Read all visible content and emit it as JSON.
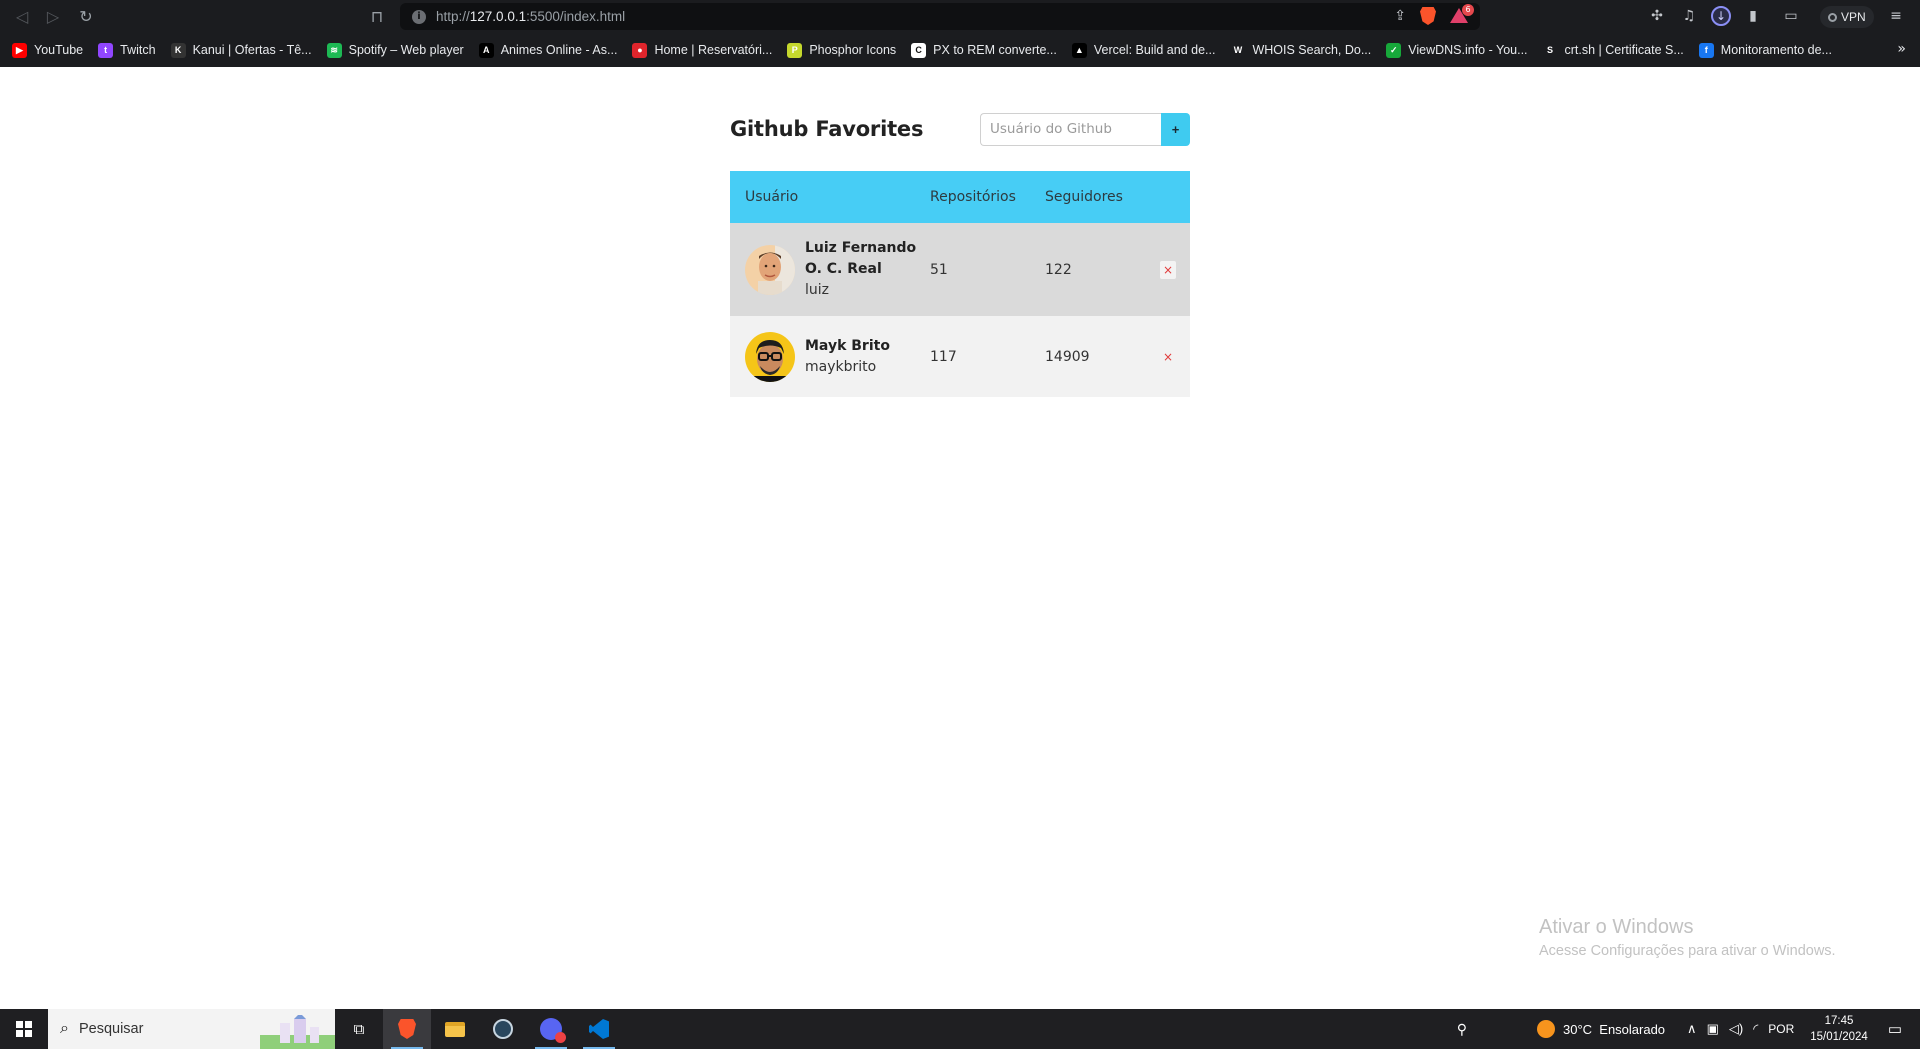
{
  "browser": {
    "url_scheme": "http://",
    "url_host": "127.0.0.1",
    "url_rest": ":5500/index.html",
    "vpn_label": "VPN",
    "notification_count": "6",
    "bookmarks": [
      {
        "label": "YouTube",
        "icon": "youtube-icon",
        "color": "#ff0000",
        "glyph": "▶"
      },
      {
        "label": "Twitch",
        "icon": "twitch-icon",
        "color": "#9146ff",
        "glyph": "t"
      },
      {
        "label": "Kanui | Ofertas - Tê...",
        "icon": "kanui-icon",
        "color": "#333333",
        "glyph": "K"
      },
      {
        "label": "Spotify – Web player",
        "icon": "spotify-icon",
        "color": "#1db954",
        "glyph": "≋"
      },
      {
        "label": "Animes Online - As...",
        "icon": "animes-icon",
        "color": "#000000",
        "glyph": "A"
      },
      {
        "label": "Home | Reservatóri...",
        "icon": "reservatorio-icon",
        "color": "#e0252c",
        "glyph": "●"
      },
      {
        "label": "Phosphor Icons",
        "icon": "phosphor-icon",
        "color": "#c5d82d",
        "glyph": "P"
      },
      {
        "label": "PX to REM converte...",
        "icon": "pxrem-icon",
        "color": "#ffffff",
        "glyph": "C"
      },
      {
        "label": "Vercel: Build and de...",
        "icon": "vercel-icon",
        "color": "#000000",
        "glyph": "▲"
      },
      {
        "label": "WHOIS Search, Do...",
        "icon": "whois-icon",
        "color": "#1b1c1f",
        "glyph": "W"
      },
      {
        "label": "ViewDNS.info - You...",
        "icon": "viewdns-icon",
        "color": "#17a83a",
        "glyph": "✓"
      },
      {
        "label": "crt.sh | Certificate S...",
        "icon": "crtsh-icon",
        "color": "#1b1c1f",
        "glyph": "S"
      },
      {
        "label": "Monitoramento de...",
        "icon": "facebook-icon",
        "color": "#1877f2",
        "glyph": "f"
      }
    ]
  },
  "app": {
    "title": "Github Favorites",
    "search_placeholder": "Usuário do Github",
    "add_label": "+",
    "columns": [
      "Usuário",
      "Repositórios",
      "Seguidores"
    ],
    "users": [
      {
        "name": "Luiz Fernando O. C. Real",
        "login": "luiz",
        "repos": "51",
        "followers": "122",
        "remove": "×"
      },
      {
        "name": "Mayk Brito",
        "login": "maykbrito",
        "repos": "117",
        "followers": "14909",
        "remove": "×"
      }
    ]
  },
  "watermark": {
    "title": "Ativar o Windows",
    "subtitle": "Acesse Configurações para ativar o Windows."
  },
  "taskbar": {
    "search_label": "Pesquisar",
    "weather": "30°C  Ensolarado",
    "language": "POR",
    "time": "17:45",
    "date": "15/01/2024"
  }
}
